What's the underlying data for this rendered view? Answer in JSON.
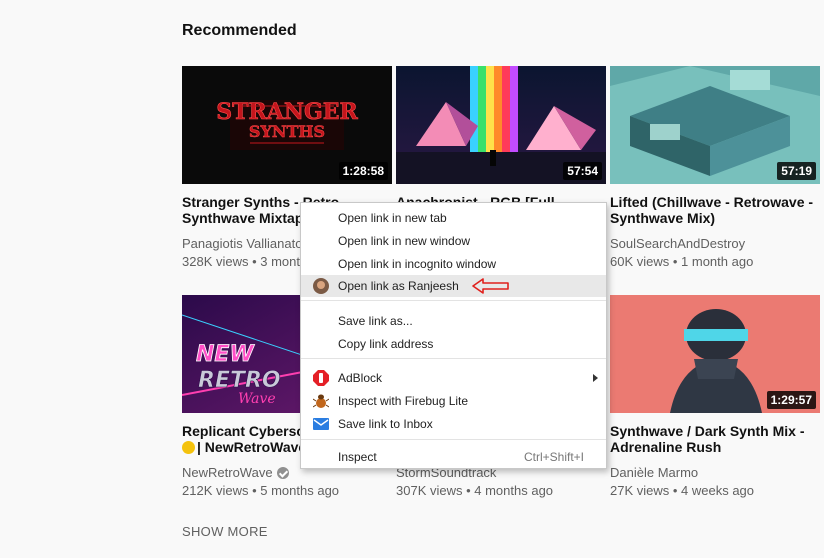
{
  "section_title": "Recommended",
  "videos": [
    {
      "title": "Stranger Synths - Retro Synthwave Mixtape",
      "channel": "Panagiotis Vallianatos",
      "meta": "328K views • 3 months ago",
      "duration": "1:28:58"
    },
    {
      "title": "Anachronist - RGB [Full",
      "channel": "",
      "meta": "",
      "duration": "57:54"
    },
    {
      "title": "Lifted (Chillwave - Retrowave - Synthwave Mix)",
      "channel": "SoulSearchAndDestroy",
      "meta": "60K views • 1 month ago",
      "duration": "57:19"
    },
    {
      "title": "Replicant Cyberscape",
      "title_line2": "| NewRetroWave",
      "channel": "NewRetroWave",
      "meta": "212K views • 5 months ago",
      "duration": ""
    },
    {
      "title": "",
      "channel": "StormSoundtrack",
      "meta": "307K views • 4 months ago",
      "duration": ""
    },
    {
      "title": "Synthwave / Dark Synth Mix - Adrenaline Rush",
      "channel": "Danièle Marmo",
      "meta": "27K views • 4 weeks ago",
      "duration": "1:29:57"
    }
  ],
  "thumb_text": {
    "stranger_line1": "STRANGER",
    "stranger_line2": "SYNTHS",
    "newretro_line1": "NEW",
    "newretro_line2": "RETRO",
    "newretro_line3": "Wave"
  },
  "context_menu": {
    "items": [
      {
        "label": "Open link in new tab"
      },
      {
        "label": "Open link in new window"
      },
      {
        "label": "Open link in incognito window"
      },
      {
        "label": "Open link as Ranjeesh"
      },
      {
        "label": "Save link as..."
      },
      {
        "label": "Copy link address"
      },
      {
        "label": "AdBlock"
      },
      {
        "label": "Inspect with Firebug Lite"
      },
      {
        "label": "Save link to Inbox"
      },
      {
        "label": "Inspect",
        "shortcut": "Ctrl+Shift+I"
      }
    ]
  },
  "show_more": "SHOW MORE",
  "colors": {
    "annotation_arrow": "#e0201c",
    "adblock": "#e42027",
    "inbox": "#2a7de1"
  }
}
